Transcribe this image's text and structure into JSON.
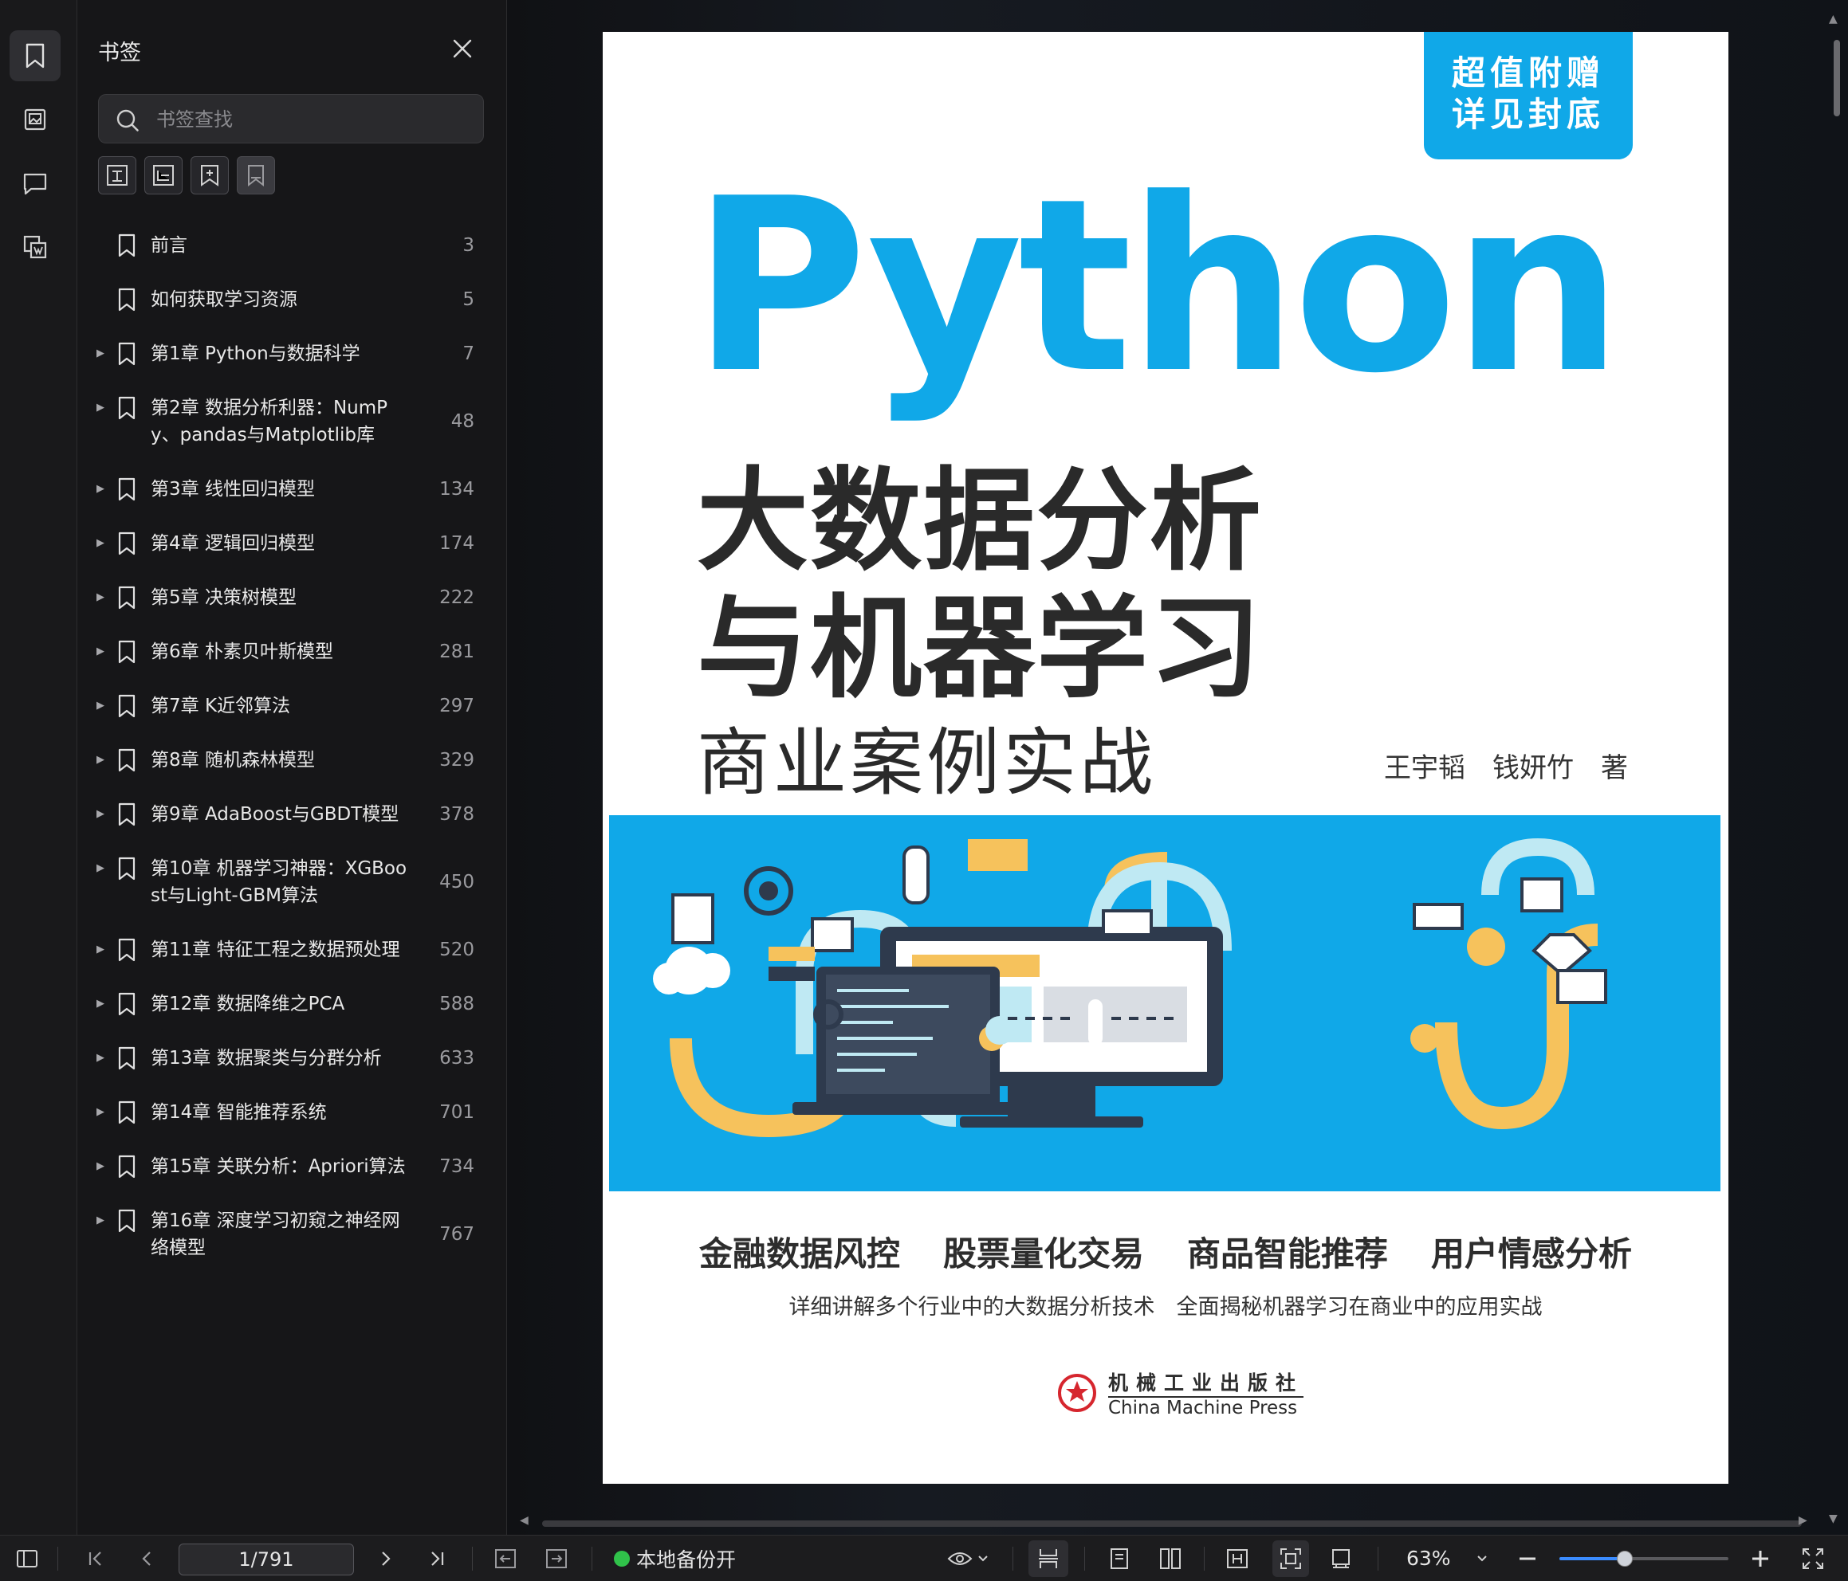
{
  "sidebar_panel": {
    "title": "书签",
    "search_placeholder": "书签查找",
    "items": [
      {
        "label": "前言",
        "page": "3",
        "expandable": false
      },
      {
        "label": "如何获取学习资源",
        "page": "5",
        "expandable": false
      },
      {
        "label": "第1章 Python与数据科学",
        "page": "7",
        "expandable": true
      },
      {
        "label": "第2章 数据分析利器：NumPy、pandas与Matplotlib库",
        "page": "48",
        "expandable": true
      },
      {
        "label": "第3章 线性回归模型",
        "page": "134",
        "expandable": true
      },
      {
        "label": "第4章 逻辑回归模型",
        "page": "174",
        "expandable": true
      },
      {
        "label": "第5章 决策树模型",
        "page": "222",
        "expandable": true
      },
      {
        "label": "第6章 朴素贝叶斯模型",
        "page": "281",
        "expandable": true
      },
      {
        "label": "第7章 K近邻算法",
        "page": "297",
        "expandable": true
      },
      {
        "label": "第8章 随机森林模型",
        "page": "329",
        "expandable": true
      },
      {
        "label": "第9章 AdaBoost与GBDT模型",
        "page": "378",
        "expandable": true
      },
      {
        "label": "第10章 机器学习神器：XGBoost与Light-GBM算法",
        "page": "450",
        "expandable": true
      },
      {
        "label": "第11章 特征工程之数据预处理",
        "page": "520",
        "expandable": true
      },
      {
        "label": "第12章 数据降维之PCA",
        "page": "588",
        "expandable": true
      },
      {
        "label": "第13章 数据聚类与分群分析",
        "page": "633",
        "expandable": true
      },
      {
        "label": "第14章 智能推荐系统",
        "page": "701",
        "expandable": true
      },
      {
        "label": "第15章 关联分析：Apriori算法",
        "page": "734",
        "expandable": true
      },
      {
        "label": "第16章 深度学习初窥之神经网络模型",
        "page": "767",
        "expandable": true
      }
    ]
  },
  "cover": {
    "badge_line1": "超值附赠",
    "badge_line2": "详见封底",
    "title_en": "Python",
    "title_line1": "大数据分析",
    "title_line2": "与机器学习",
    "title_line3": "商业案例实战",
    "authors": "王宇韬　钱妍竹　著",
    "tags": [
      "金融数据风控",
      "股票量化交易",
      "商品智能推荐",
      "用户情感分析"
    ],
    "subtitle": "详细讲解多个行业中的大数据分析技术　全面揭秘机器学习在商业中的应用实战",
    "publisher_cn": "机械工业出版社",
    "publisher_en": "China Machine Press"
  },
  "statusbar": {
    "page_indicator": "1/791",
    "backup_label": "本地备份开",
    "zoom_label": "63%",
    "zoom_level": 0.63
  },
  "colors": {
    "accent": "#10a8e8",
    "status_dot": "#30c24a",
    "slider": "#3b8cff"
  },
  "icons": {
    "rail": [
      "bookmark-icon",
      "thumbnail-icon",
      "comment-icon",
      "attachment-icon"
    ],
    "bm_tools": [
      "add-bookmark-icon",
      "add-child-bookmark-icon",
      "bookmark-star-icon",
      "bookmark-outline-icon"
    ]
  }
}
